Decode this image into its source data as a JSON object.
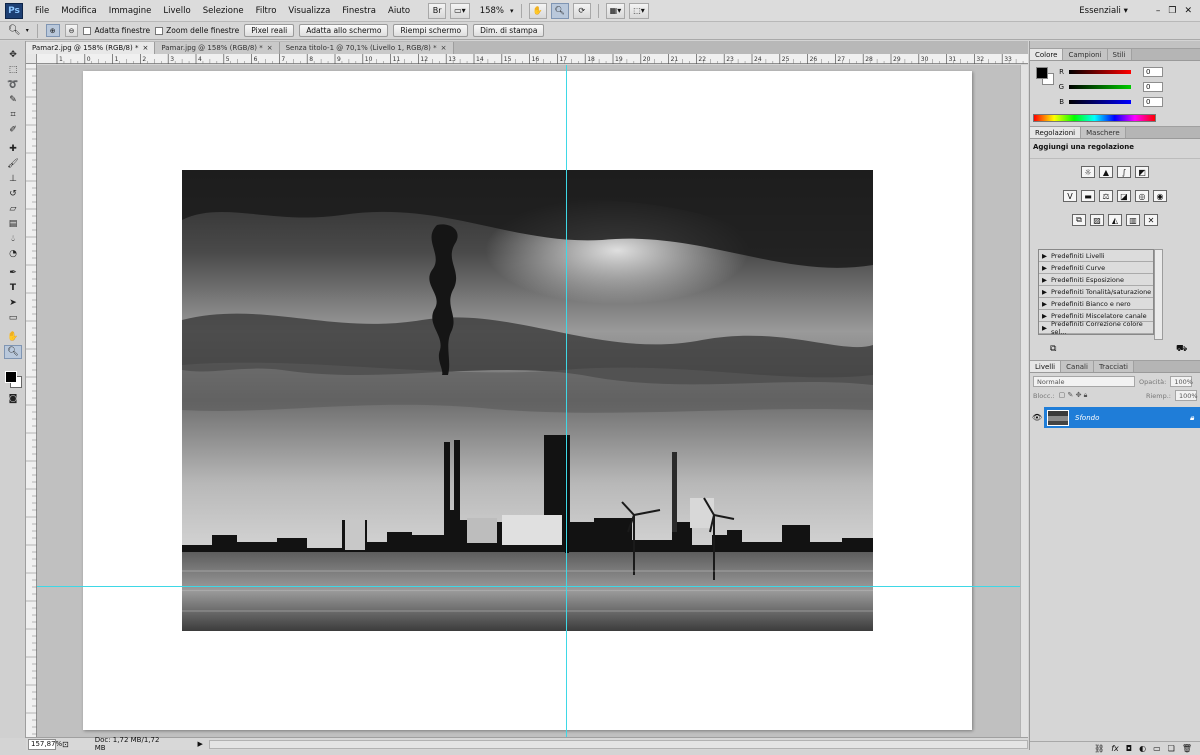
{
  "app": {
    "logo": "Ps"
  },
  "menu": [
    "File",
    "Modifica",
    "Immagine",
    "Livello",
    "Selezione",
    "Filtro",
    "Visualizza",
    "Finestra",
    "Aiuto"
  ],
  "menu_tools": {
    "bridge": "Br",
    "zoom_level": "158%"
  },
  "workspace": {
    "name": "Essenziali"
  },
  "options_bar": {
    "fit_windows": "Adatta finestre",
    "zoom_all_windows": "Zoom delle finestre",
    "actual_pixels": "Pixel reali",
    "fit_screen": "Adatta allo schermo",
    "fill_screen": "Riempi schermo",
    "print_size": "Dim. di stampa"
  },
  "doc_tabs": [
    {
      "label": "Pamar2.jpg @ 158% (RGB/8) *",
      "active": true
    },
    {
      "label": "Pamar.jpg @ 158% (RGB/8) *",
      "active": false
    },
    {
      "label": "Senza titolo-1 @ 70,1% (Livello 1, RGB/8) *",
      "active": false
    }
  ],
  "ruler_ticks": [
    "1",
    "0",
    "1",
    "2",
    "3",
    "4",
    "5",
    "6",
    "7",
    "8",
    "9",
    "10",
    "11",
    "12",
    "13",
    "14",
    "15",
    "16",
    "17",
    "18",
    "19",
    "20",
    "21",
    "22",
    "23",
    "24",
    "25",
    "26",
    "27",
    "28",
    "29",
    "30",
    "31",
    "32",
    "33"
  ],
  "status": {
    "zoom": "157,87%",
    "doc_info": "Doc: 1,72 MB/1,72 MB"
  },
  "color_panel": {
    "tabs": [
      "Colore",
      "Campioni",
      "Stili"
    ],
    "r_label": "R",
    "g_label": "G",
    "b_label": "B",
    "r": "0",
    "g": "0",
    "b": "0",
    "fg_color": "#000000",
    "bg_color": "#ffffff"
  },
  "adjustments_panel": {
    "tabs": [
      "Regolazioni",
      "Maschere"
    ],
    "heading": "Aggiungi una regolazione",
    "presets": [
      "Predefiniti Livelli",
      "Predefiniti Curve",
      "Predefiniti Esposizione",
      "Predefiniti Tonalità/saturazione",
      "Predefiniti Bianco e nero",
      "Predefiniti Miscelatore canale",
      "Predefiniti Correzione colore sel..."
    ]
  },
  "layers_panel": {
    "tabs": [
      "Livelli",
      "Canali",
      "Tracciati"
    ],
    "blend_mode": "Normale",
    "opacity_label": "Opacità:",
    "opacity": "100%",
    "lock_label": "Blocc.:",
    "fill_label": "Riemp.:",
    "fill": "100%",
    "layers": [
      {
        "name": "Sfondo"
      }
    ]
  },
  "colors": {
    "accent": "#1f7dd8",
    "guide": "#3ed8e6"
  }
}
